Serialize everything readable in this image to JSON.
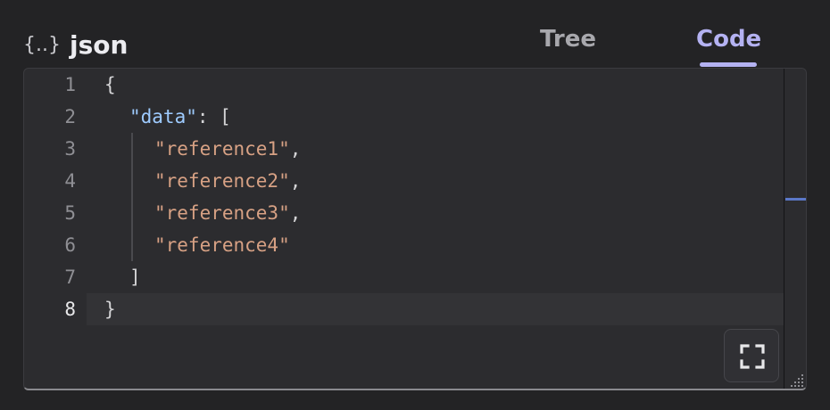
{
  "header": {
    "icon_glyph": "{..}",
    "icon_name": "braces-icon",
    "title": "json"
  },
  "tabs": [
    {
      "label": "Tree",
      "active": false
    },
    {
      "label": "Code",
      "active": true
    }
  ],
  "editor": {
    "line_numbers": [
      "1",
      "2",
      "3",
      "4",
      "5",
      "6",
      "7",
      "8"
    ],
    "active_line": "8",
    "lines": [
      {
        "tokens": [
          {
            "t": "{",
            "k": "punc"
          }
        ]
      },
      {
        "tokens": [
          {
            "t": "\"data\"",
            "k": "key"
          },
          {
            "t": ": [",
            "k": "punc"
          }
        ]
      },
      {
        "tokens": [
          {
            "t": "\"reference1\"",
            "k": "str"
          },
          {
            "t": ",",
            "k": "punc"
          }
        ]
      },
      {
        "tokens": [
          {
            "t": "\"reference2\"",
            "k": "str"
          },
          {
            "t": ",",
            "k": "punc"
          }
        ]
      },
      {
        "tokens": [
          {
            "t": "\"reference3\"",
            "k": "str"
          },
          {
            "t": ",",
            "k": "punc"
          }
        ]
      },
      {
        "tokens": [
          {
            "t": "\"reference4\"",
            "k": "str"
          }
        ]
      },
      {
        "tokens": [
          {
            "t": "]",
            "k": "punc"
          }
        ]
      },
      {
        "tokens": [
          {
            "t": "}",
            "k": "punc"
          }
        ]
      }
    ]
  },
  "icons": {
    "fullscreen": "expand-icon",
    "resize": "resize-grip-icon"
  },
  "colors": {
    "accent": "#b4b2f2",
    "key": "#9ecbff",
    "string": "#d7a184",
    "background": "#232325",
    "editor_background": "#2c2c2f"
  }
}
